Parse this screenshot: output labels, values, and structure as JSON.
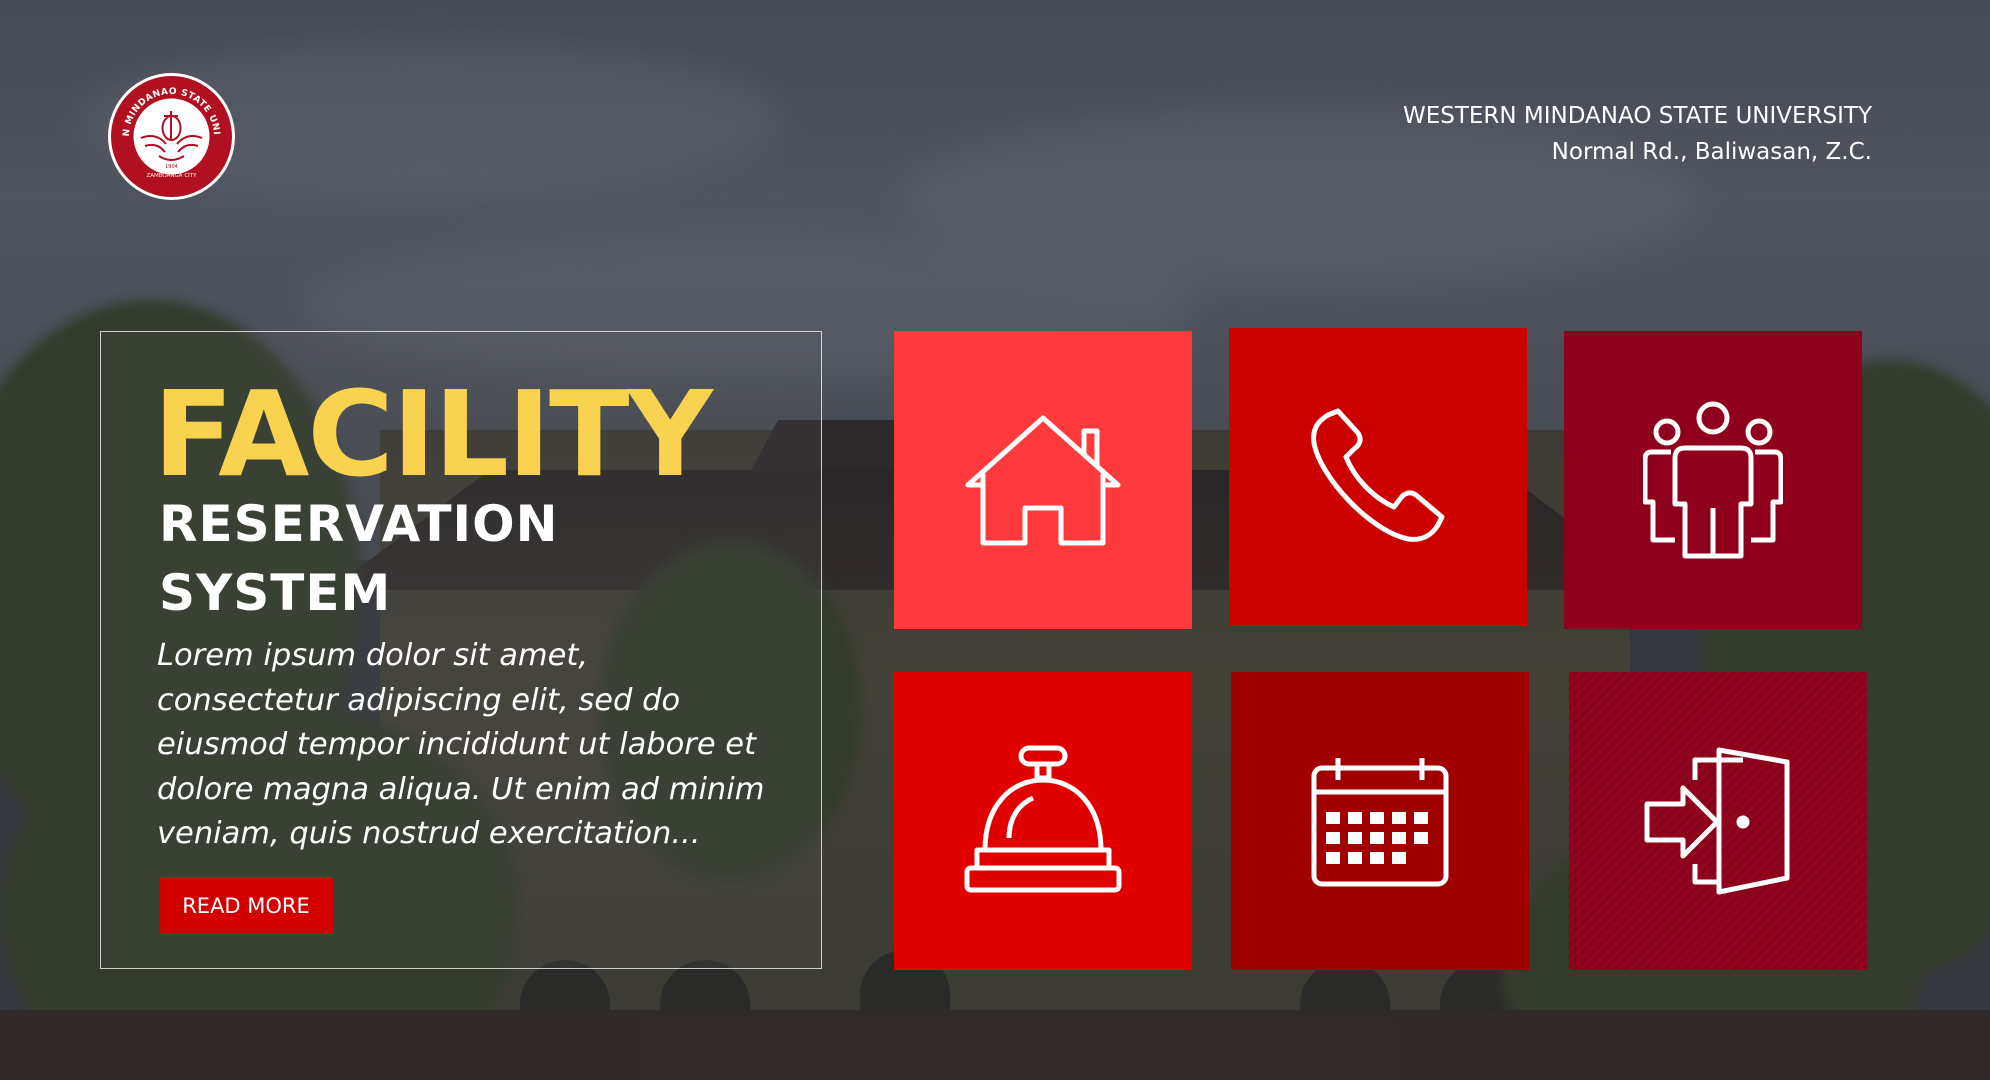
{
  "header": {
    "university_name": "WESTERN MINDANAO STATE UNIVERSITY",
    "address": "Normal Rd., Baliwasan, Z.C.",
    "logo": {
      "icon": "university-seal-icon",
      "seal_text": "WESTERN MINDANAO STATE UNIVERSITY",
      "seal_year": "1904",
      "seal_city": "ZAMBOANGA CITY"
    }
  },
  "hero": {
    "title": "FACILITY",
    "subtitle_line1": "RESERVATION",
    "subtitle_line2": "SYSTEM",
    "description": "Lorem ipsum dolor sit amet, consectetur adipiscing elit, sed do eiusmod tempor incididunt ut labore et dolore magna aliqua. Ut enim ad minim veniam, quis nostrud exercitation...",
    "button_label": "READ MORE"
  },
  "tiles": [
    {
      "icon": "home-icon",
      "color": "#fe3a3d"
    },
    {
      "icon": "phone-icon",
      "color": "#cd0000"
    },
    {
      "icon": "people-icon",
      "color": "#8f001c"
    },
    {
      "icon": "service-bell-icon",
      "color": "#e10000"
    },
    {
      "icon": "calendar-icon",
      "color": "#a10000"
    },
    {
      "icon": "exit-door-icon",
      "color": "#8c001a"
    }
  ],
  "colors": {
    "accent_yellow": "#f9d350",
    "button_red": "#d40000"
  }
}
